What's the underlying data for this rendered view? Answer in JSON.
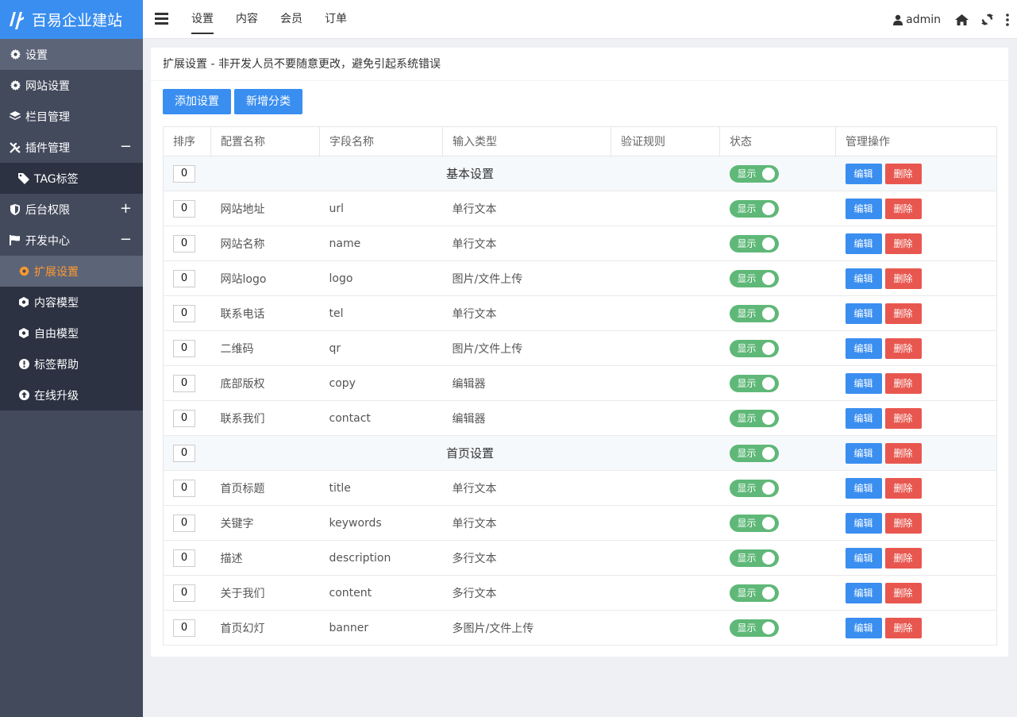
{
  "brand": {
    "name": "百易企业建站"
  },
  "sidebar": {
    "items": [
      {
        "label": "设置",
        "icon": "gear-icon",
        "type": "parent-active"
      },
      {
        "label": "网站设置",
        "icon": "gear-icon",
        "type": "item"
      },
      {
        "label": "栏目管理",
        "icon": "layers-icon",
        "type": "item"
      },
      {
        "label": "插件管理",
        "icon": "tools-icon",
        "type": "item",
        "toggle": "−"
      },
      {
        "label": "TAG标签",
        "icon": "tag-icon",
        "type": "sub"
      },
      {
        "label": "后台权限",
        "icon": "shield-icon",
        "type": "item",
        "toggle": "+"
      },
      {
        "label": "开发中心",
        "icon": "flag-icon",
        "type": "item",
        "toggle": "−"
      },
      {
        "label": "扩展设置",
        "icon": "gear-icon",
        "type": "sub-current"
      },
      {
        "label": "内容模型",
        "icon": "cube-icon",
        "type": "sub"
      },
      {
        "label": "自由模型",
        "icon": "cube-icon",
        "type": "sub"
      },
      {
        "label": "标签帮助",
        "icon": "info-icon",
        "type": "sub"
      },
      {
        "label": "在线升级",
        "icon": "upload-icon",
        "type": "sub"
      }
    ]
  },
  "topnav": {
    "tabs": [
      "设置",
      "内容",
      "会员",
      "订单"
    ],
    "active": 0
  },
  "topright": {
    "user": "admin"
  },
  "panel": {
    "title": "扩展设置 - 非开发人员不要随意更改，避免引起系统错误",
    "buttons": [
      "添加设置",
      "新增分类"
    ]
  },
  "table": {
    "headers": [
      "排序",
      "配置名称",
      "字段名称",
      "输入类型",
      "验证规则",
      "状态",
      "管理操作"
    ],
    "status_label": "显示",
    "edit_label": "编辑",
    "delete_label": "删除",
    "rows": [
      {
        "group": true,
        "sort": "0",
        "name": "基本设置"
      },
      {
        "sort": "0",
        "name": "网站地址",
        "field": "url",
        "type": "单行文本"
      },
      {
        "sort": "0",
        "name": "网站名称",
        "field": "name",
        "type": "单行文本"
      },
      {
        "sort": "0",
        "name": "网站logo",
        "field": "logo",
        "type": "图片/文件上传"
      },
      {
        "sort": "0",
        "name": "联系电话",
        "field": "tel",
        "type": "单行文本"
      },
      {
        "sort": "0",
        "name": "二维码",
        "field": "qr",
        "type": "图片/文件上传"
      },
      {
        "sort": "0",
        "name": "底部版权",
        "field": "copy",
        "type": "编辑器"
      },
      {
        "sort": "0",
        "name": "联系我们",
        "field": "contact",
        "type": "编辑器"
      },
      {
        "group": true,
        "sort": "0",
        "name": "首页设置"
      },
      {
        "sort": "0",
        "name": "首页标题",
        "field": "title",
        "type": "单行文本"
      },
      {
        "sort": "0",
        "name": "关键字",
        "field": "keywords",
        "type": "单行文本"
      },
      {
        "sort": "0",
        "name": "描述",
        "field": "description",
        "type": "多行文本"
      },
      {
        "sort": "0",
        "name": "关于我们",
        "field": "content",
        "type": "多行文本"
      },
      {
        "sort": "0",
        "name": "首页幻灯",
        "field": "banner",
        "type": "多图片/文件上传"
      }
    ]
  },
  "colors": {
    "brand_blue": "#3a8ef0",
    "sidebar_bg": "#434a5c",
    "accent_orange": "#ff9a2e",
    "switch_green": "#5fb878",
    "delete_red": "#e8574f"
  }
}
